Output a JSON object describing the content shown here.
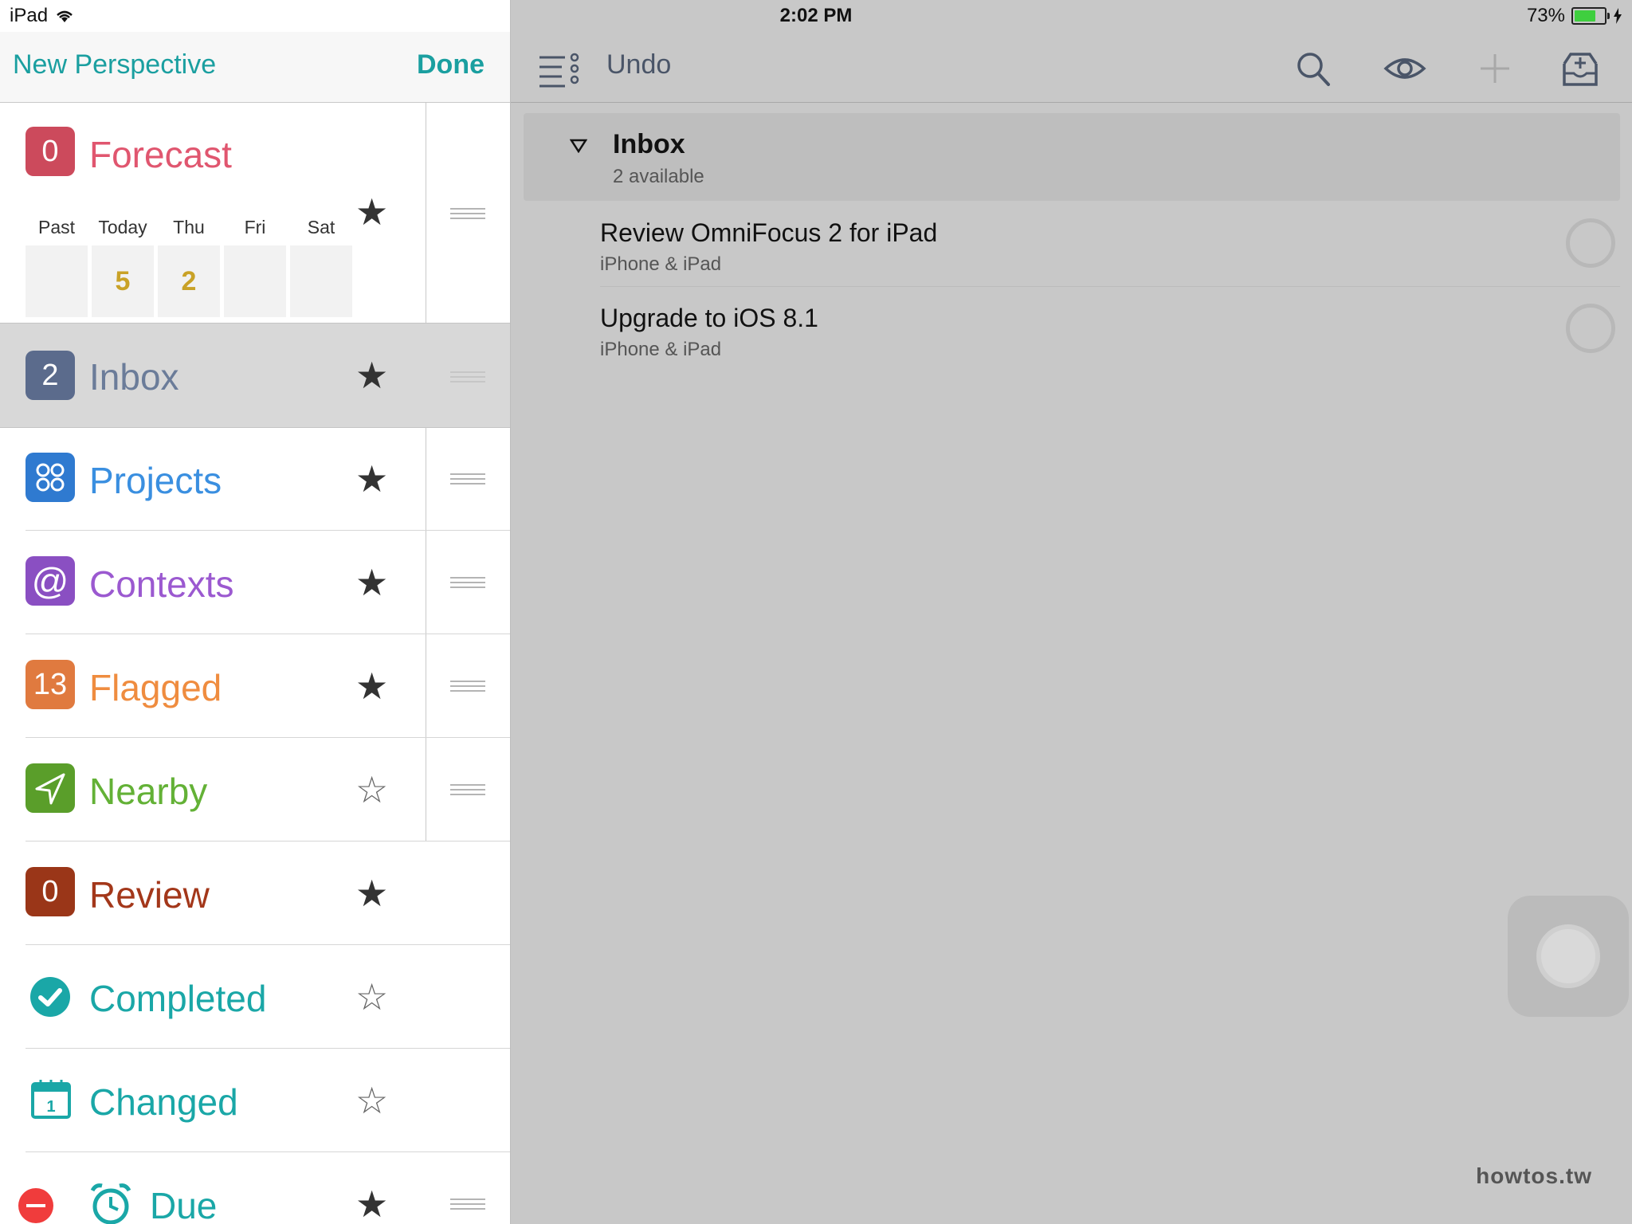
{
  "status_bar": {
    "device": "iPad",
    "time": "2:02 PM",
    "battery": "73%",
    "battery_level": 0.73
  },
  "sidebar": {
    "title": "New Perspective",
    "done_label": "Done",
    "forecast": {
      "badge": "0",
      "label": "Forecast",
      "color": "#e0566f",
      "days": [
        "Past",
        "Today",
        "Thu",
        "Fri",
        "Sat"
      ],
      "counts": [
        "",
        "5",
        "2",
        "",
        ""
      ]
    },
    "items": [
      {
        "badge": "2",
        "label": "Inbox",
        "color": "#5b6b8c",
        "label_color": "#6b7c99",
        "icon": "inbox-badge",
        "starred": true
      },
      {
        "badge": "",
        "label": "Projects",
        "color": "#2f7ad0",
        "label_color": "#3a8fe0",
        "icon": "projects-icon",
        "starred": true
      },
      {
        "badge": "@",
        "label": "Contexts",
        "color": "#8a4fc2",
        "label_color": "#9b59d0",
        "icon": "contexts-icon",
        "starred": true
      },
      {
        "badge": "13",
        "label": "Flagged",
        "color": "#e07a3f",
        "label_color": "#ef8c3f",
        "icon": "flagged-badge",
        "starred": true
      },
      {
        "badge": "",
        "label": "Nearby",
        "color": "#5a9e2a",
        "label_color": "#63b136",
        "icon": "location-arrow-icon",
        "starred": false
      },
      {
        "badge": "0",
        "label": "Review",
        "color": "#9a3618",
        "label_color": "#a3371a",
        "icon": "review-badge",
        "starred": true
      },
      {
        "badge": "",
        "label": "Completed",
        "color": "#1aa7a7",
        "label_color": "#1aa7a7",
        "icon": "checkmark-circle-icon",
        "starred": false
      },
      {
        "badge": "1",
        "label": "Changed",
        "color": "#1aa7a7",
        "label_color": "#1aa7a7",
        "icon": "calendar-icon",
        "starred": false
      },
      {
        "badge": "",
        "label": "Due",
        "color": "#1aa7a7",
        "label_color": "#1aa7a7",
        "icon": "alarm-clock-icon",
        "starred": true
      }
    ]
  },
  "toolbar": {
    "undo_label": "Undo"
  },
  "inbox": {
    "title": "Inbox",
    "subtitle": "2 available",
    "tasks": [
      {
        "title": "Review OmniFocus 2 for iPad",
        "subtitle": "iPhone & iPad"
      },
      {
        "title": "Upgrade to iOS 8.1",
        "subtitle": "iPhone & iPad"
      }
    ]
  },
  "watermark": "howtos.tw"
}
